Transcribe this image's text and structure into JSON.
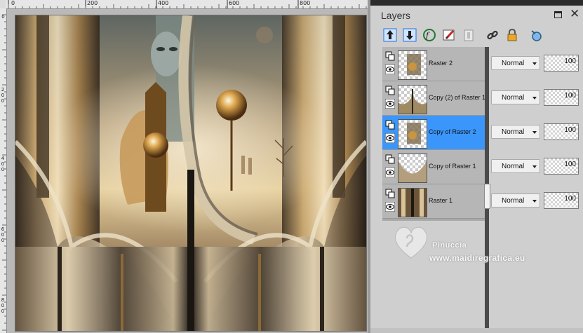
{
  "panel": {
    "title": "Layers",
    "menu_icon": "window-menu-icon",
    "close_icon": "close-icon"
  },
  "toolbar": [
    {
      "name": "move-layer-up-icon"
    },
    {
      "name": "move-layer-down-icon"
    },
    {
      "name": "new-layer-icon"
    },
    {
      "name": "edit-brush-icon"
    },
    {
      "name": "mask-icon"
    },
    {
      "name": "link-icon"
    },
    {
      "name": "lock-icon"
    },
    {
      "name": "layer-style-icon"
    }
  ],
  "layers": [
    {
      "name": "Raster 2",
      "blend": "Normal",
      "opacity": "100",
      "selected": false
    },
    {
      "name": "Copy (2) of Raster 1",
      "blend": "Normal",
      "opacity": "100",
      "selected": false
    },
    {
      "name": "Copy of Raster 2",
      "blend": "Normal",
      "opacity": "100",
      "selected": true
    },
    {
      "name": "Copy of Raster 1",
      "blend": "Normal",
      "opacity": "100",
      "selected": false
    },
    {
      "name": "Raster 1",
      "blend": "Normal",
      "opacity": "100",
      "selected": false
    }
  ],
  "ruler_top": [
    "0",
    "200",
    "400",
    "600",
    "800"
  ],
  "ruler_left": [
    "0",
    "2 0 0",
    "4 0 0",
    "6 0 0",
    "8 0 0"
  ],
  "watermark": {
    "name": "Pinuccia",
    "url": "www.maidiregrafica.eu"
  },
  "colors": {
    "selection": "#3a96fb",
    "panel_bg": "#cfcfcf",
    "list_bg": "#b6b6b6"
  }
}
